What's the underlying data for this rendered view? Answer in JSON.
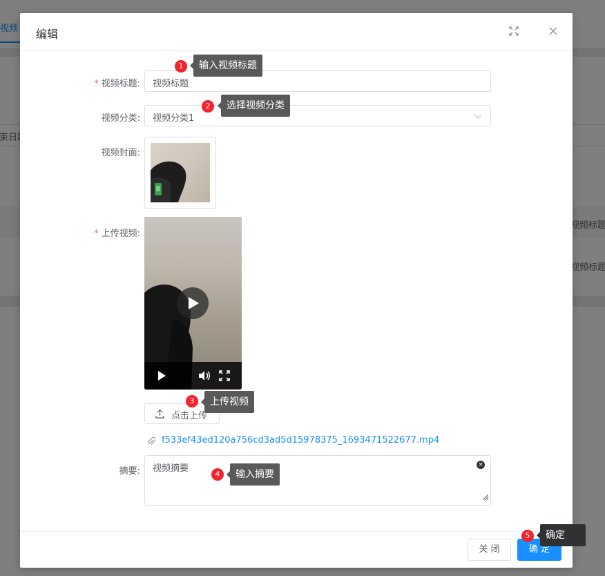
{
  "background": {
    "tab_label": "视频",
    "date_hint": "束日期",
    "col_header": "视频标题",
    "cell_value": "视频标题"
  },
  "dialog": {
    "title": "编辑",
    "fields": {
      "title_label": "视频标题:",
      "title_value": "视频标题",
      "category_label": "视频分类:",
      "category_value": "视频分类1",
      "cover_label": "视频封面:",
      "video_label": "上传视频:",
      "summary_label": "摘要:",
      "summary_value": "视频摘要"
    },
    "upload_button": "点击上传",
    "uploaded_file": "f533ef43ed120a756cd3ad5d15978375_1693471522677.mp4",
    "close_button": "关 闭",
    "confirm_button": "确 定"
  },
  "tour": [
    {
      "num": "1",
      "text": "输入视频标题"
    },
    {
      "num": "2",
      "text": "选择视频分类"
    },
    {
      "num": "3",
      "text": "上传视频"
    },
    {
      "num": "4",
      "text": "输入摘要"
    },
    {
      "num": "5",
      "text": "确定"
    }
  ],
  "colors": {
    "primary": "#1890ff",
    "required": "#f56c6c",
    "tour_badge": "#f5222d",
    "tour_tip": "#595959"
  },
  "icons": [
    "fullscreen-icon",
    "close-icon",
    "chevron-down-icon",
    "upload-icon",
    "paperclip-icon",
    "play-icon",
    "volume-icon",
    "fullscreen-video-icon",
    "clear-icon",
    "resize-handle-icon"
  ]
}
